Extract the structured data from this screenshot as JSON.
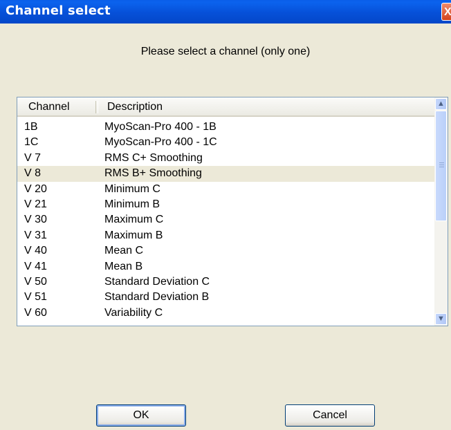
{
  "window": {
    "title": "Channel select",
    "close_label": "X"
  },
  "prompt": "Please select a channel (only one)",
  "list": {
    "columns": [
      "Channel",
      "Description"
    ],
    "rows": [
      {
        "channel": "1B",
        "description": "MyoScan-Pro 400 - 1B"
      },
      {
        "channel": "1C",
        "description": "MyoScan-Pro 400 - 1C"
      },
      {
        "channel": "V 7",
        "description": "RMS C+ Smoothing"
      },
      {
        "channel": "V 8",
        "description": "RMS B+ Smoothing",
        "selected": true
      },
      {
        "channel": "V 20",
        "description": "Minimum C"
      },
      {
        "channel": "V 21",
        "description": "Minimum B"
      },
      {
        "channel": "V 30",
        "description": "Maximum C"
      },
      {
        "channel": "V 31",
        "description": "Maximum B"
      },
      {
        "channel": "V 40",
        "description": "Mean C"
      },
      {
        "channel": "V 41",
        "description": "Mean B"
      },
      {
        "channel": "V 50",
        "description": "Standard Deviation C"
      },
      {
        "channel": "V 51",
        "description": "Standard Deviation B"
      },
      {
        "channel": "V 60",
        "description": "Variability C"
      }
    ]
  },
  "scrollbar": {
    "up_icon": "chevron-up-icon",
    "down_icon": "chevron-down-icon"
  },
  "buttons": {
    "ok": "OK",
    "cancel": "Cancel"
  },
  "colors": {
    "title_bar": "#0a5ee8",
    "dialog_bg": "#ece9d8",
    "selected_row": "#ece9d8"
  }
}
